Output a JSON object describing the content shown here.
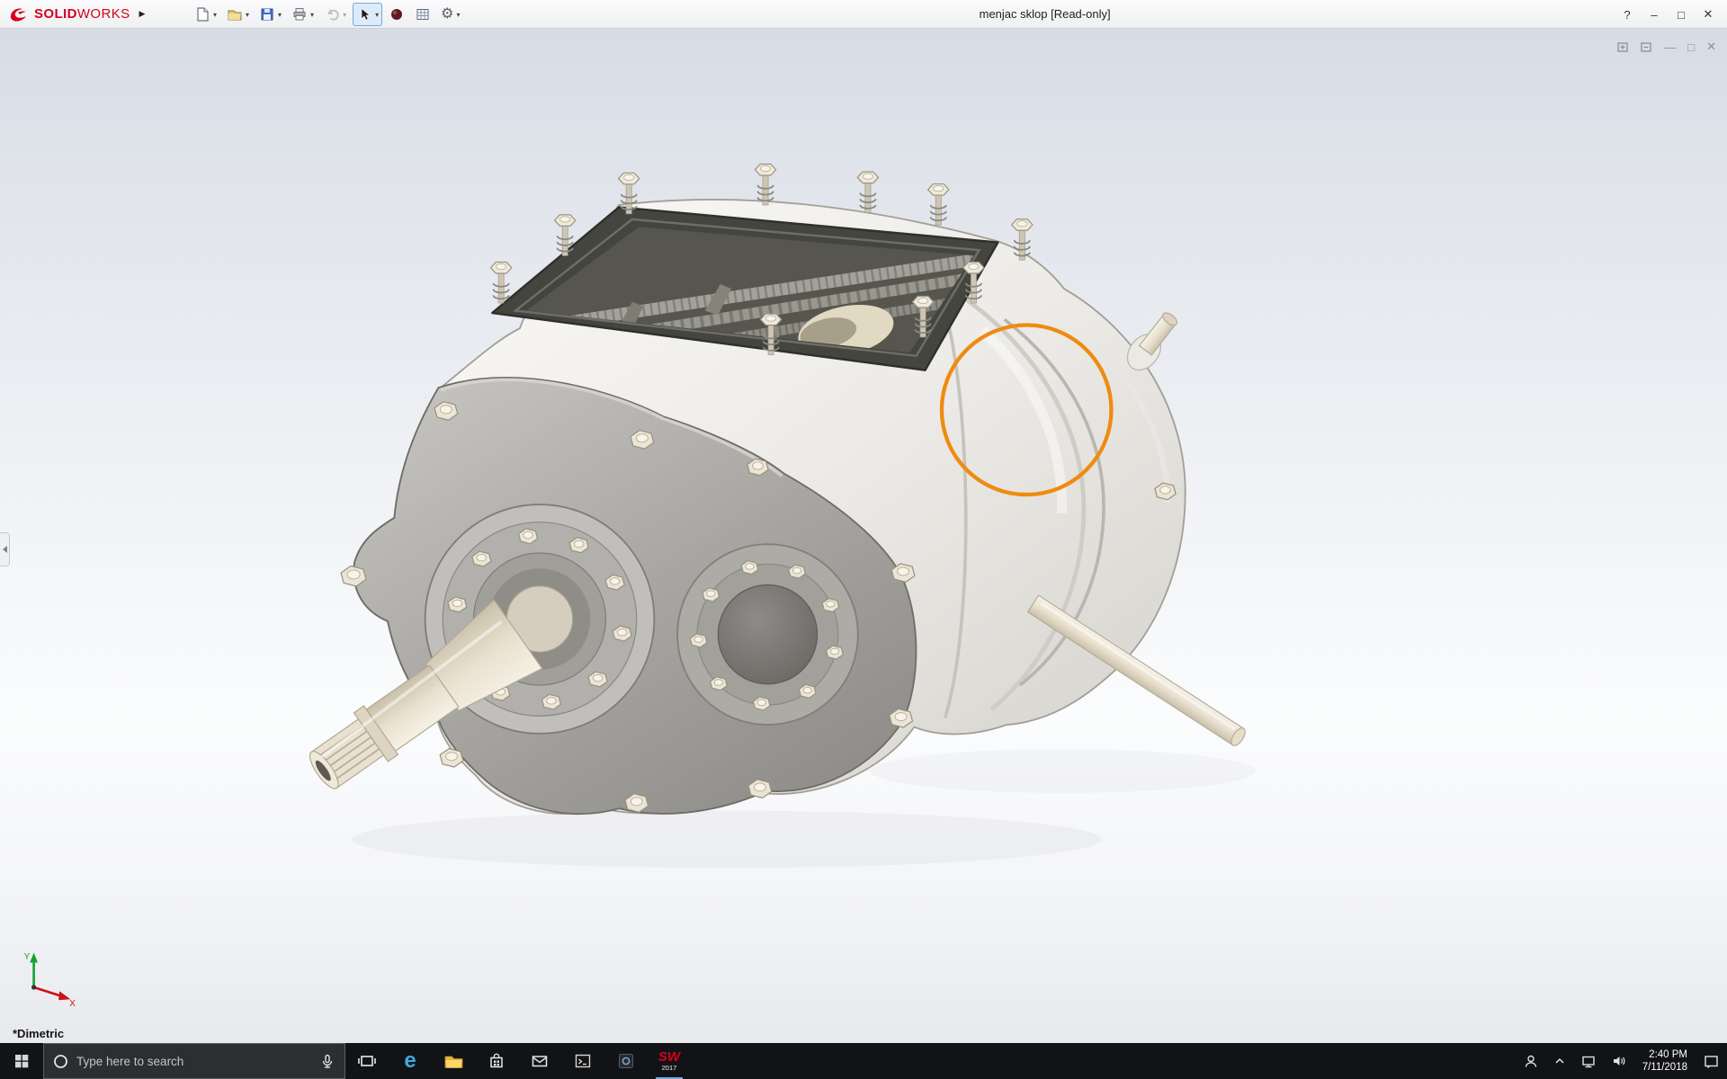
{
  "titlebar": {
    "brand": {
      "solid": "SOLID",
      "works": "WORKS"
    },
    "flyout_arrow": "▶",
    "document_title": "menjac sklop [Read-only]",
    "controls": {
      "help": "?",
      "minimize": "–",
      "maximize": "□",
      "close": "✕"
    }
  },
  "toolbar": {
    "caret": "▾",
    "gear_glyph": "⚙",
    "buttons": [
      {
        "name": "new-document"
      },
      {
        "name": "open"
      },
      {
        "name": "save"
      },
      {
        "name": "print"
      },
      {
        "name": "undo",
        "disabled": true
      },
      {
        "name": "select",
        "selected": true
      },
      {
        "name": "macro-record"
      },
      {
        "name": "design-table"
      },
      {
        "name": "options"
      }
    ]
  },
  "childwindow": {
    "minimize": "—",
    "restore": "□",
    "close": "✕"
  },
  "viewport": {
    "view_label": "*Dimetric",
    "annotation_color": "#ef8b10",
    "triad": {
      "x_label": "X",
      "y_label": "Y"
    }
  },
  "taskbar": {
    "search_placeholder": "Type here to search",
    "edge_glyph": "e",
    "solidworks": {
      "line1": "SW",
      "line2": "2017"
    },
    "clock": {
      "time": "2:40 PM",
      "date": "7/11/2018"
    }
  }
}
